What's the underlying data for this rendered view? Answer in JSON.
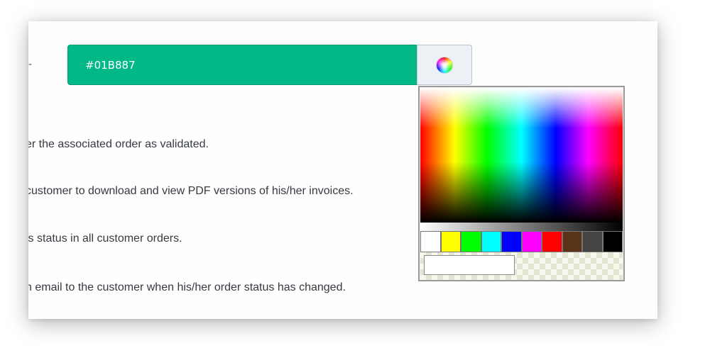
{
  "color_field": {
    "value": "#01B887",
    "background": "#01B887"
  },
  "picker_button": {
    "icon": "color-wheel-icon"
  },
  "status_options": [
    {
      "text": "er the associated order as validated."
    },
    {
      "text": " customer to download and view PDF versions of his/her invoices."
    },
    {
      "text": "is status in all customer orders."
    },
    {
      "text": "n email to the customer when his/her order status has changed."
    }
  ],
  "color_picker": {
    "swatches": [
      "#ffffff",
      "#ffff00",
      "#00ff00",
      "#00ffff",
      "#0000ff",
      "#ff00ff",
      "#ff0000",
      "#5a3416",
      "#444444",
      "#000000"
    ],
    "hex_value": ""
  }
}
